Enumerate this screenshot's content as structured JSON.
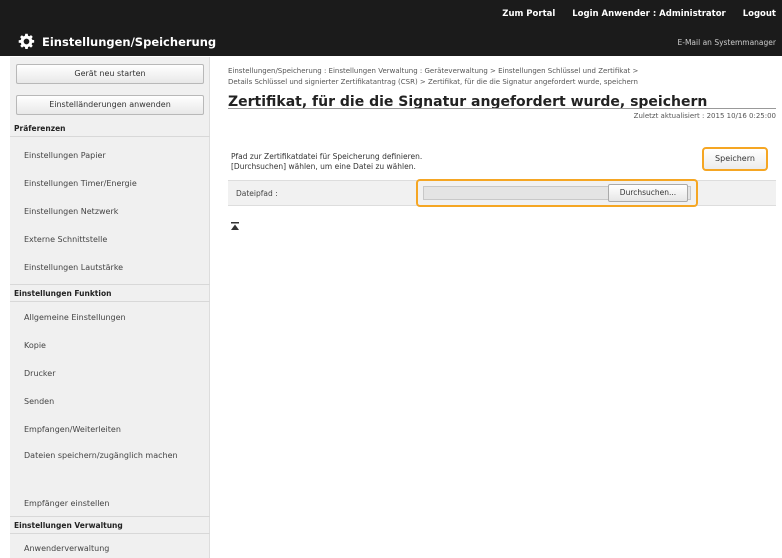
{
  "header": {
    "links": [
      "Zum Portal",
      "Login Anwender : Administrator",
      "Logout"
    ],
    "title": "Einstellungen/Speicherung",
    "mail_link": "E-Mail an Systemmanager"
  },
  "sidebar": {
    "buttons": [
      "Gerät neu starten",
      "Einstelländerungen anwenden"
    ],
    "sections": [
      {
        "heading": "Präferenzen",
        "items": [
          "Einstellungen Papier",
          "Einstellungen Timer/Energie",
          "Einstellungen Netzwerk",
          "Externe Schnittstelle",
          "Einstellungen Lautstärke"
        ]
      },
      {
        "heading": "Einstellungen Funktion",
        "items": [
          "Allgemeine Einstellungen",
          "Kopie",
          "Drucker",
          "Senden",
          "Empfangen/Weiterleiten",
          "Dateien speichern/zugänglich machen",
          "Empfänger einstellen"
        ]
      },
      {
        "heading": "Einstellungen Verwaltung",
        "items": [
          "Anwenderverwaltung"
        ]
      }
    ]
  },
  "main": {
    "breadcrumb_line1": "Einstellungen/Speicherung : Einstellungen Verwaltung : Geräteverwaltung > Einstellungen Schlüssel und Zertifikat >",
    "breadcrumb_line2": "Details Schlüssel und signierter Zertifikatantrag (CSR) > Zertifikat, für die die Signatur angefordert wurde, speichern",
    "title": "Zertifikat, für die die Signatur angefordert wurde, speichern",
    "updated": "Zuletzt aktualisiert : 2015 10/16 0:25:00",
    "description_line1": "Pfad zur Zertifikatdatei für Speicherung definieren.",
    "description_line2": "[Durchsuchen] wählen, um eine Datei zu wählen.",
    "save_label": "Speichern",
    "file_path_label": "Dateipfad :",
    "file_path_value": "",
    "browse_label": "Durchsuchen...",
    "highlight_color": "#f5a623"
  }
}
